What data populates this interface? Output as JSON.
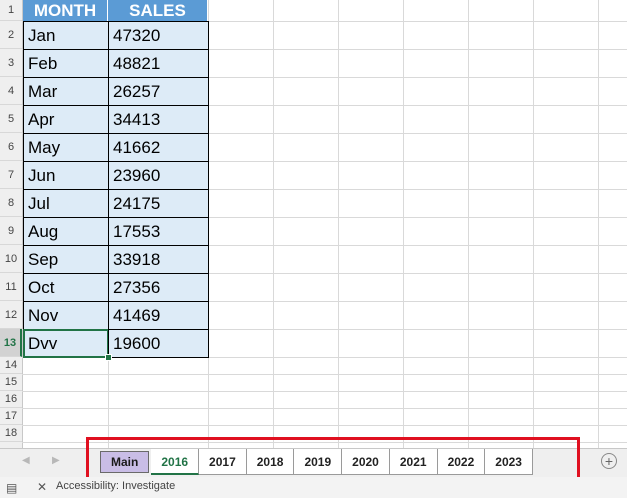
{
  "columns": {
    "month": "MONTH",
    "sales": "SALES"
  },
  "row_numbers": [
    "1",
    "2",
    "3",
    "4",
    "5",
    "6",
    "7",
    "8",
    "9",
    "10",
    "11",
    "12",
    "13",
    "14",
    "15",
    "16",
    "17",
    "18"
  ],
  "rows": [
    {
      "month": "Jan",
      "sales": "47320"
    },
    {
      "month": "Feb",
      "sales": "48821"
    },
    {
      "month": "Mar",
      "sales": "26257"
    },
    {
      "month": "Apr",
      "sales": "34413"
    },
    {
      "month": "May",
      "sales": "41662"
    },
    {
      "month": "Jun",
      "sales": "23960"
    },
    {
      "month": "Jul",
      "sales": "24175"
    },
    {
      "month": "Aug",
      "sales": "17553"
    },
    {
      "month": "Sep",
      "sales": "33918"
    },
    {
      "month": "Oct",
      "sales": "27356"
    },
    {
      "month": "Nov",
      "sales": "41469"
    },
    {
      "month": "Dvv",
      "sales": "19600"
    }
  ],
  "tabs": [
    "Main",
    "2016",
    "2017",
    "2018",
    "2019",
    "2020",
    "2021",
    "2022",
    "2023"
  ],
  "active_tab": "2016",
  "nav": {
    "prev": "◀",
    "next": "▶",
    "add": "+"
  },
  "status": {
    "accessibility": "Accessibility: Investigate",
    "mode_icon": "sheet-mode-icon",
    "acc_icon": "accessibility-icon"
  },
  "colors": {
    "header_fill": "#5b9bd5",
    "data_fill": "#ddebf7",
    "accent": "#217346",
    "highlight": "#e01020",
    "main_tab": "#c9bde6"
  }
}
